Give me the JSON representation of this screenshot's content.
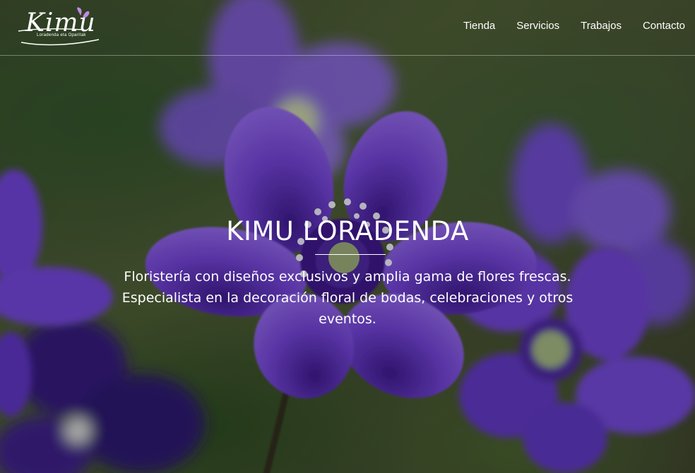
{
  "brand": {
    "logo_word": "Kimu",
    "logo_tagline": "Loradenda eta Oparitak"
  },
  "nav": {
    "items": [
      {
        "label": "Tienda"
      },
      {
        "label": "Servicios"
      },
      {
        "label": "Trabajos"
      },
      {
        "label": "Contacto"
      }
    ]
  },
  "hero": {
    "title": "KIMU LORADENDA",
    "description": "Floristería con diseños exclusivos y amplia gama de flores frescas. Especialista en la decoración floral de bodas, celebraciones y otros eventos."
  },
  "colors": {
    "petal": "#6b3fc7",
    "petal_dark": "#4a2796",
    "logo_accent": "#c08be0",
    "text": "#ffffff"
  }
}
